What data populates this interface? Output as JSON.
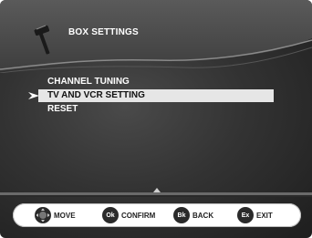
{
  "header": {
    "title": "BOX SETTINGS",
    "icon": "hammer-icon"
  },
  "menu": {
    "items": [
      {
        "label": "CHANNEL TUNING"
      },
      {
        "label": "TV AND VCR SETTING",
        "selected": true
      },
      {
        "label": "RESET"
      }
    ]
  },
  "footer": {
    "items": [
      {
        "icon_text": "",
        "icon": "dpad-icon",
        "label": "MOVE"
      },
      {
        "icon_text": "Ok",
        "icon": "ok-button-icon",
        "label": "CONFIRM"
      },
      {
        "icon_text": "Bk",
        "icon": "back-button-icon",
        "label": "BACK"
      },
      {
        "icon_text": "Ex",
        "icon": "exit-button-icon",
        "label": "EXIT"
      }
    ]
  },
  "colors": {
    "background": "#333333",
    "highlight": "#e6e6e6",
    "text": "#ffffff",
    "footer_bg": "#ffffff"
  }
}
